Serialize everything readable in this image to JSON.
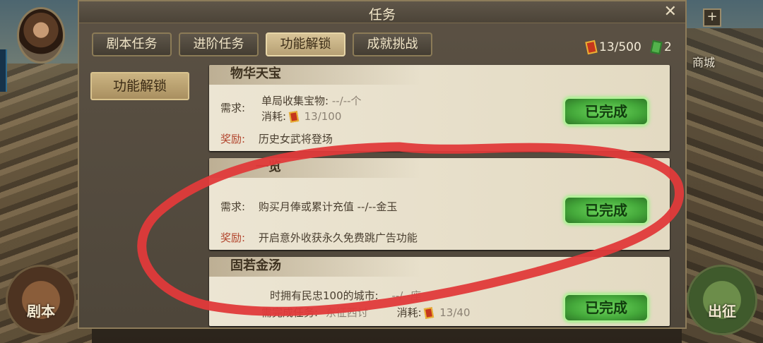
{
  "background": {
    "shop_label": "商城",
    "left_button": "剧本",
    "right_button": "出征",
    "plus": "+"
  },
  "dialog": {
    "title": "任务",
    "close": "✕",
    "tabs": [
      {
        "label": "剧本任务",
        "active": false
      },
      {
        "label": "进阶任务",
        "active": false
      },
      {
        "label": "功能解锁",
        "active": true
      },
      {
        "label": "成就挑战",
        "active": false
      }
    ],
    "currency": {
      "tickets": "13/500",
      "gems": "2"
    },
    "side_button": "功能解锁",
    "cards": [
      {
        "title": "物华天宝",
        "req_label": "需求:",
        "req_line1": "单局收集宝物:",
        "req_line1_value": "--/--个",
        "cost_label": "消耗:",
        "cost_value": "13/100",
        "reward_label": "奖励:",
        "reward_text": "历史女武将登场",
        "button": "已完成"
      },
      {
        "title": "一览",
        "req_label": "需求:",
        "req_line1": "购买月俸或累计充值",
        "req_line1_value": "--/--金玉",
        "reward_label": "奖励:",
        "reward_text": "开启意外收获永久免费跳广告功能",
        "button": "已完成"
      },
      {
        "title": "固若金汤",
        "req_line1": "时拥有民忠100的城市:",
        "req_line1_value": "--/--座",
        "req_task_label": "需完成任务:",
        "req_task_value": "东征西讨",
        "cost_label": "消耗:",
        "cost_value": "13/40",
        "button": "已完成"
      }
    ]
  }
}
